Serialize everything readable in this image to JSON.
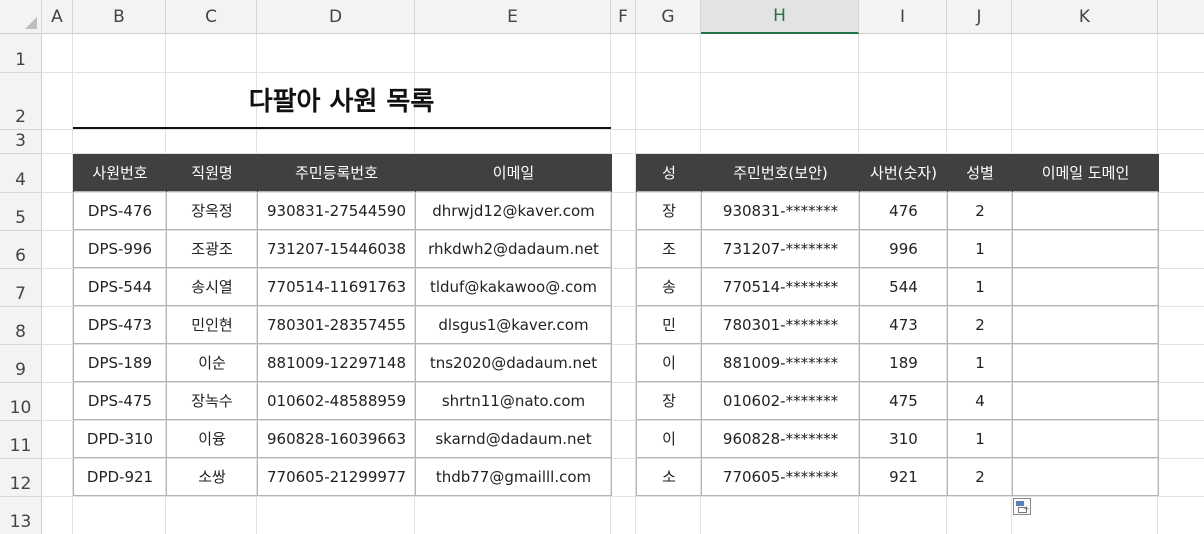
{
  "columns": [
    "A",
    "B",
    "C",
    "D",
    "E",
    "F",
    "G",
    "H",
    "I",
    "J",
    "K"
  ],
  "rows": [
    "1",
    "2",
    "3",
    "4",
    "5",
    "6",
    "7",
    "8",
    "9",
    "10",
    "11",
    "12",
    "13"
  ],
  "title": "다팔아 사원 목록",
  "left_table": {
    "headers": [
      "사원번호",
      "직원명",
      "주민등록번호",
      "이메일"
    ],
    "rows": [
      [
        "DPS-476",
        "장옥정",
        "930831-27544590",
        "dhrwjd12@kaver.com"
      ],
      [
        "DPS-996",
        "조광조",
        "731207-15446038",
        "rhkdwh2@dadaum.net"
      ],
      [
        "DPS-544",
        "송시열",
        "770514-11691763",
        "tlduf@kakawoo@.com"
      ],
      [
        "DPS-473",
        "민인현",
        "780301-28357455",
        "dlsgus1@kaver.com"
      ],
      [
        "DPS-189",
        "이순",
        "881009-12297148",
        "tns2020@dadaum.net"
      ],
      [
        "DPS-475",
        "장녹수",
        "010602-48588959",
        "shrtn11@nato.com"
      ],
      [
        "DPD-310",
        "이융",
        "960828-16039663",
        "skarnd@dadaum.net"
      ],
      [
        "DPD-921",
        "소쌍",
        "770605-21299977",
        "thdb77@gmailll.com"
      ]
    ]
  },
  "right_table": {
    "headers": [
      "성",
      "주민번호(보안)",
      "사번(숫자)",
      "성별",
      "이메일 도메인"
    ],
    "rows": [
      [
        "장",
        "930831-*******",
        "476",
        "2",
        ""
      ],
      [
        "조",
        "731207-*******",
        "996",
        "1",
        ""
      ],
      [
        "송",
        "770514-*******",
        "544",
        "1",
        ""
      ],
      [
        "민",
        "780301-*******",
        "473",
        "2",
        ""
      ],
      [
        "이",
        "881009-*******",
        "189",
        "1",
        ""
      ],
      [
        "장",
        "010602-*******",
        "475",
        "4",
        ""
      ],
      [
        "이",
        "960828-*******",
        "310",
        "1",
        ""
      ],
      [
        "소",
        "770605-*******",
        "921",
        "2",
        ""
      ]
    ]
  },
  "selected_column": "H"
}
